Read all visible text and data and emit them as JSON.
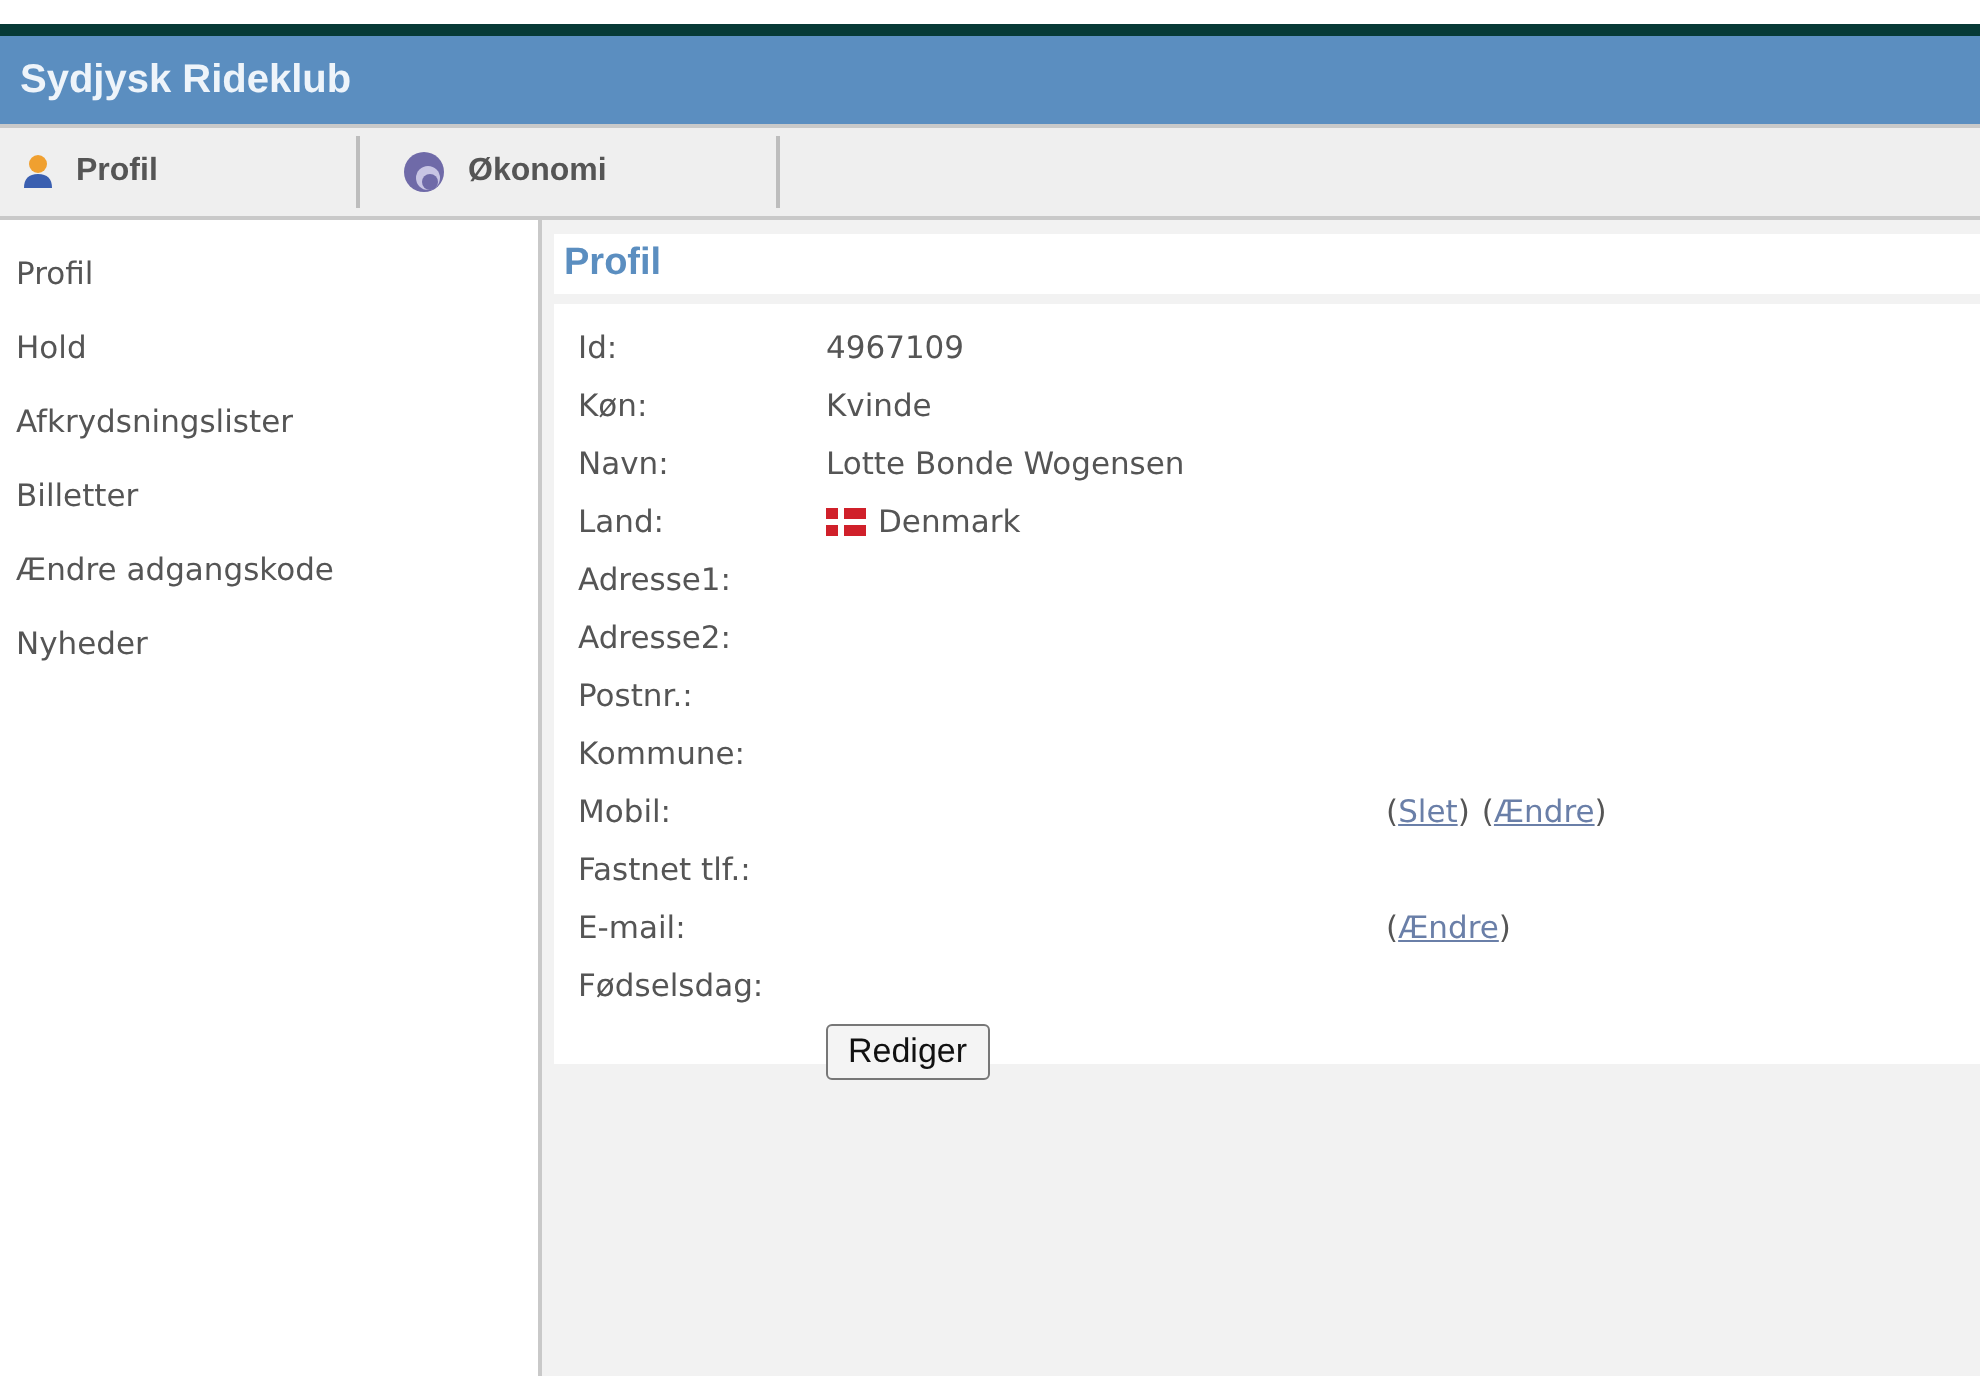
{
  "header": {
    "title": "Sydjysk Rideklub"
  },
  "tabs": [
    {
      "label": "Profil",
      "kind": "person"
    },
    {
      "label": "Økonomi",
      "kind": "swirl"
    }
  ],
  "sidebar": {
    "items": [
      "Profil",
      "Hold",
      "Afkrydsningslister",
      "Billetter",
      "Ændre adgangskode",
      "Nyheder"
    ]
  },
  "profile": {
    "title": "Profil",
    "fields": [
      {
        "label": "Id:",
        "value": "4967109"
      },
      {
        "label": "Køn:",
        "value": "Kvinde"
      },
      {
        "label": "Navn:",
        "value": "Lotte Bonde Wogensen"
      },
      {
        "label": "Land:",
        "value": "Denmark",
        "flag": true
      },
      {
        "label": "Adresse1:"
      },
      {
        "label": "Adresse2:"
      },
      {
        "label": "Postnr.:"
      },
      {
        "label": "Kommune:"
      },
      {
        "label": "Mobil:",
        "actions": [
          {
            "before": "(",
            "link": "Slet",
            "after": ")"
          },
          {
            "before": "(",
            "link": "Ændre",
            "after": ")"
          }
        ]
      },
      {
        "label": "Fastnet tlf.:"
      },
      {
        "label": "E-mail:",
        "actions": [
          {
            "before": "(",
            "link": "Ændre",
            "after": ")"
          }
        ]
      },
      {
        "label": "Fødselsdag:"
      }
    ],
    "button": "Rediger"
  }
}
